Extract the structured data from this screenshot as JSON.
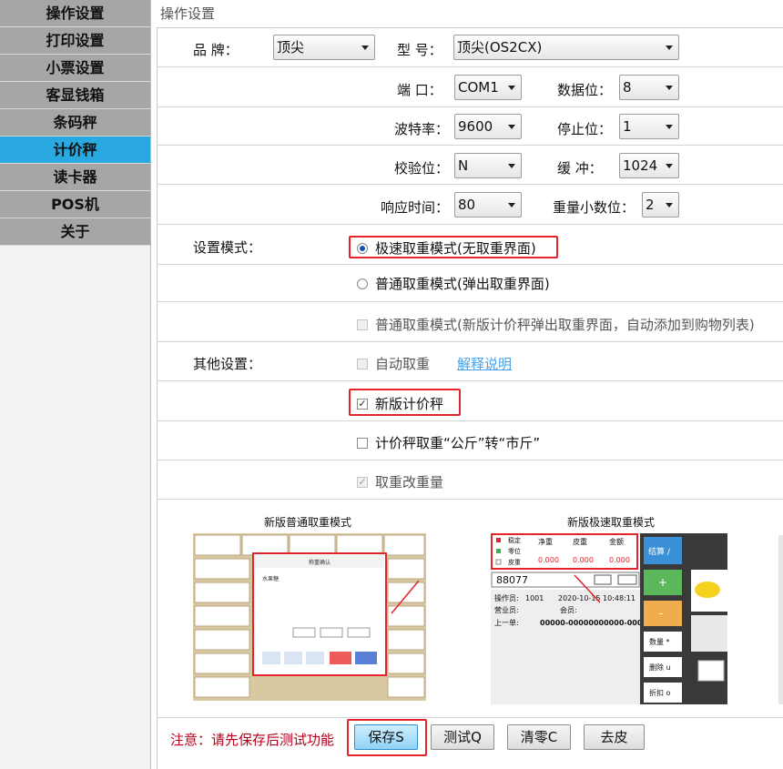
{
  "sidebar": {
    "items": [
      {
        "label": "操作设置"
      },
      {
        "label": "打印设置"
      },
      {
        "label": "小票设置"
      },
      {
        "label": "客显钱箱"
      },
      {
        "label": "条码秤"
      },
      {
        "label": "计价秤",
        "active": true
      },
      {
        "label": "读卡器"
      },
      {
        "label": "POS机"
      },
      {
        "label": "关于"
      }
    ]
  },
  "breadcrumb": "操作设置",
  "form": {
    "brand_label": "品  牌：",
    "brand_value": "顶尖",
    "model_label": "型  号：",
    "model_value": "顶尖(OS2CX)",
    "port_label": "端  口：",
    "port_value": "COM1",
    "databits_label": "数据位：",
    "databits_value": "8",
    "baud_label": "波特率：",
    "baud_value": "9600",
    "stopbits_label": "停止位：",
    "stopbits_value": "1",
    "parity_label": "校验位：",
    "parity_value": "N",
    "buffer_label": "缓  冲：",
    "buffer_value": "1024",
    "response_label": "响应时间：",
    "response_value": "80",
    "decimals_label": "重量小数位：",
    "decimals_value": "2"
  },
  "mode": {
    "label": "设置模式：",
    "fast": "极速取重模式(无取重界面)",
    "normal": "普通取重模式(弹出取重界面)",
    "normal_new": "普通取重模式(新版计价秤弹出取重界面，自动添加到购物列表)"
  },
  "other": {
    "label": "其他设置：",
    "auto": "自动取重",
    "help_link": "解释说明",
    "new_scale": "新版计价秤",
    "jin": "计价秤取重“公斤”转“市斤”",
    "reweigh": "取重改重量"
  },
  "previews": {
    "normal_title": "新版普通取重模式",
    "fast_title": "新版极速取重模式",
    "fast_input": "88077",
    "fast_operator_label": "操作员:",
    "fast_operator": "1001",
    "fast_datetime": "2020-10-15 10:48:11",
    "fast_sales_label": "营业员:",
    "fast_member_label": "会员:",
    "fast_last_label": "上一单:",
    "fast_last": "00000-00000000000-0000",
    "fast_stable": "稳定",
    "fast_zero": "零位",
    "fast_tare": "皮重",
    "fast_net_h": "净重",
    "fast_tare_h": "皮重",
    "fast_amount_h": "金额",
    "fast_zero_val": "0.000",
    "fast_checkout": "结算 /",
    "fast_qty": "数量 *",
    "fast_del": "删除 u",
    "fast_discount": "折扣 o",
    "normal_dialog_title": "称重确认",
    "normal_item": "水果糖"
  },
  "footer": {
    "notice": "注意：请先保存后测试功能",
    "save": "保存S",
    "test": "测试Q",
    "clear": "清零C",
    "peel": "去皮"
  }
}
